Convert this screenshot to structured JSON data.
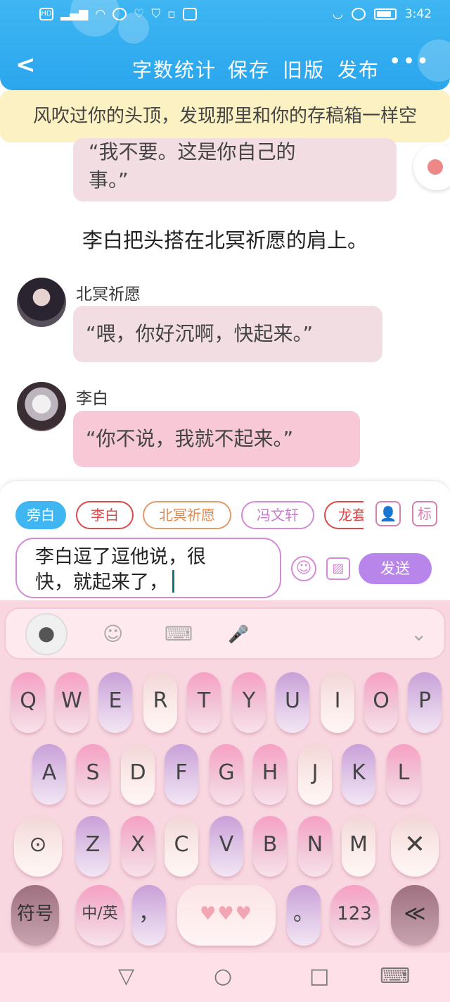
{
  "status": {
    "left_icons": [
      "HD",
      "5G",
      "signal",
      "wifi",
      "vpn",
      "heart",
      "shield",
      "nfc",
      "app"
    ],
    "time": "3:42"
  },
  "header": {
    "back": "<",
    "word_count": "字数统计",
    "save": "保存",
    "old_version": "旧版",
    "publish": "发布",
    "more": "•••"
  },
  "notice": "风吹过你的头顶，发现那里和你的存稿箱一样空",
  "chat": {
    "prev_text_1": "“我不要。这是你自己的",
    "prev_text_2": "事。”",
    "narration": "李白把头搭在北冥祈愿的肩上。",
    "messages": [
      {
        "speaker": "北冥祈愿",
        "text": "“喂，你好沉啊，快起来。”"
      },
      {
        "speaker": "李白",
        "text": "“你不说，我就不起来。”"
      }
    ]
  },
  "composer": {
    "chips": [
      "旁白",
      "李白",
      "北冥祈愿",
      "冯文轩",
      "龙套"
    ],
    "role_btn": "👤",
    "mark_btn": "标",
    "input_line1": "李白逗了逗他说，很",
    "input_line2": "快，就起来了，",
    "emoji": "☺",
    "image": "▨",
    "send": "发送"
  },
  "keyboard": {
    "bar": {
      "qq": "●",
      "emoji": "☺",
      "keyboard": "⌨",
      "mic": "🎤",
      "collapse": "⌄"
    },
    "row1": [
      "Q",
      "W",
      "E",
      "R",
      "T",
      "Y",
      "U",
      "I",
      "O",
      "P"
    ],
    "row2": [
      "A",
      "S",
      "D",
      "F",
      "G",
      "H",
      "J",
      "K",
      "L"
    ],
    "row3": [
      "Z",
      "X",
      "C",
      "V",
      "B",
      "N",
      "M"
    ],
    "search": "⊙",
    "delete": "✕",
    "symbols": "符号",
    "lang": "中/英",
    "comma": "，",
    "space": "♥♥♥",
    "period": "。",
    "num": "123",
    "enter": "≪"
  },
  "nav": {
    "back": "▽",
    "home": "○",
    "recent": "□",
    "keyboard": "⌨"
  }
}
